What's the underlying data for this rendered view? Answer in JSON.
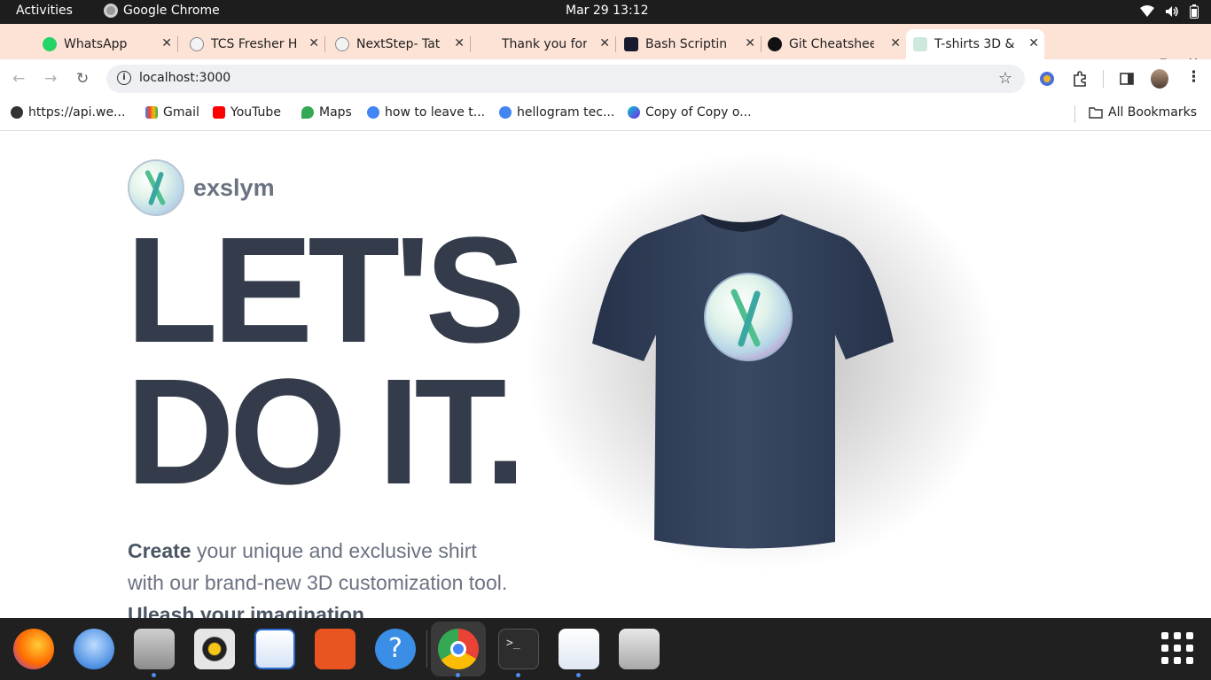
{
  "system_bar": {
    "activities": "Activities",
    "app_name": "Google Chrome",
    "clock": "Mar 29  13:12"
  },
  "tabs": [
    {
      "title": "WhatsApp",
      "icon": "whatsapp-icon",
      "active": false
    },
    {
      "title": "TCS Fresher H",
      "icon": "tcs-icon",
      "active": false
    },
    {
      "title": "NextStep- Tat",
      "icon": "tcs-icon",
      "active": false
    },
    {
      "title": "Thank you for",
      "icon": "blank-icon",
      "active": false
    },
    {
      "title": "Bash Scriptin",
      "icon": "bash-icon",
      "active": false
    },
    {
      "title": "Git Cheatshee",
      "icon": "cs-icon",
      "active": false
    },
    {
      "title": "T-shirts 3D &",
      "icon": "exslym-icon",
      "active": true
    }
  ],
  "address_bar": {
    "url": "localhost:3000"
  },
  "bookmarks": [
    {
      "label": "https://api.we...",
      "icon": "globe-icon"
    },
    {
      "label": "Gmail",
      "icon": "gmail-icon"
    },
    {
      "label": "YouTube",
      "icon": "youtube-icon"
    },
    {
      "label": "Maps",
      "icon": "maps-icon"
    },
    {
      "label": "how to leave t...",
      "icon": "google-icon"
    },
    {
      "label": "hellogram tec...",
      "icon": "google-icon"
    },
    {
      "label": "Copy of Copy o...",
      "icon": "canva-icon"
    }
  ],
  "all_bookmarks": "All Bookmarks",
  "page": {
    "brand_name": "exslym",
    "hero_line1": "LET'S",
    "hero_line2": "DO IT.",
    "tagline_strong1": "Create",
    "tagline_text": " your unique and exclusive shirt with our brand-new 3D customization tool. ",
    "tagline_strong2": "Uleash your imagination"
  },
  "colors": {
    "tab_strip": "#fde3d6",
    "hero_text": "#343c4b",
    "shirt": "#34425a"
  },
  "dock": {
    "apps": [
      "firefox-icon",
      "thunderbird-icon",
      "files-icon",
      "rhythmbox-icon",
      "writer-icon",
      "app-center-icon",
      "help-icon",
      "chrome-icon",
      "terminal-icon",
      "text-editor-icon",
      "trash-icon"
    ]
  }
}
